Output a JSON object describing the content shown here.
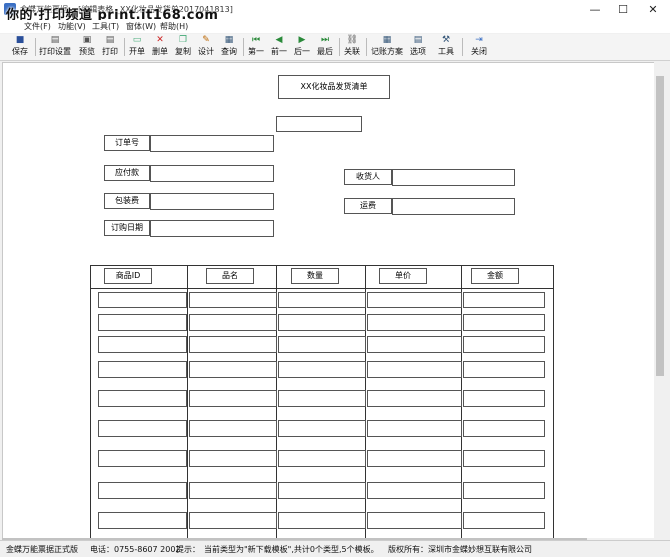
{
  "window": {
    "title": "金蝶万能票据...  [编辑表格 _XX化妆品发货单2017041813]",
    "watermark": "你的·打印频道 print.it168.com",
    "controls": {
      "minimize": "—",
      "maximize": "☐",
      "close": "✕"
    }
  },
  "menu": [
    "文件(F)",
    "功能(V)",
    "工具(T)",
    "窗体(W)",
    "帮助(H)"
  ],
  "toolbar": [
    {
      "label": "保存",
      "icon": "save-icon"
    },
    {
      "label": "打印设置",
      "icon": "print-settings-icon"
    },
    {
      "label": "预览",
      "icon": "preview-icon"
    },
    {
      "label": "打印",
      "icon": "print-icon"
    },
    {
      "label": "开单",
      "icon": "new-bill-icon"
    },
    {
      "label": "删单",
      "icon": "delete-bill-icon"
    },
    {
      "label": "复制",
      "icon": "copy-icon"
    },
    {
      "label": "设计",
      "icon": "design-icon"
    },
    {
      "label": "查询",
      "icon": "query-icon"
    },
    {
      "label": "第一",
      "icon": "first-icon"
    },
    {
      "label": "前一",
      "icon": "prev-icon"
    },
    {
      "label": "后一",
      "icon": "next-icon"
    },
    {
      "label": "最后",
      "icon": "last-icon"
    },
    {
      "label": "关联",
      "icon": "link-icon"
    },
    {
      "label": "记账方案",
      "icon": "accounting-icon"
    },
    {
      "label": "选项",
      "icon": "options-icon"
    },
    {
      "label": "工具",
      "icon": "tools-icon"
    },
    {
      "label": "关闭",
      "icon": "close-doc-icon"
    }
  ],
  "form": {
    "title": "XX化妆品发货清单",
    "fields": {
      "order_no": "订单号",
      "payable": "应付款",
      "packing_fee": "包装费",
      "order_date": "订购日期",
      "receiver": "收货人",
      "freight": "运费"
    },
    "table_headers": [
      "商品ID",
      "品名",
      "数量",
      "单价",
      "金额"
    ]
  },
  "status": {
    "edition": "金蝶万能票据正式版",
    "phone": "电话：0755-8607 2002",
    "tip_label": "提示：",
    "tip_text": "当前类型为\"新下载模板\",共计0个类型,5个模板。",
    "copyright": "版权所有：深圳市金蝶妙想互联有限公司"
  },
  "colors": {
    "accent": "#3a6fc4",
    "border": "#555555"
  }
}
